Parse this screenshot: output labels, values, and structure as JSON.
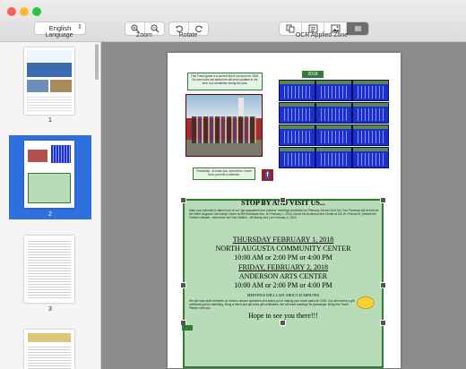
{
  "toolbar": {
    "language_value": "English",
    "language_label": "Language",
    "zoom_label": "Zoom",
    "rotate_label": "Rotate",
    "ocr_label": "OCR Applied Zone"
  },
  "icons": {
    "zoom_in": "zoom-in-icon",
    "zoom_out": "zoom-out-icon",
    "rotate_left": "rotate-left-icon",
    "rotate_right": "rotate-right-icon"
  },
  "sidebar": {
    "pages": [
      {
        "number": "1"
      },
      {
        "number": "2",
        "selected": true
      },
      {
        "number": "3"
      },
      {
        "number": ""
      }
    ],
    "selected_color": "#2f6fde"
  },
  "document": {
    "top_note": "This Travel guide is a current list of our tours for 2018. No new tours are added we will send updates in the form of a newsletter during the year.",
    "year_badge": "2018",
    "friendship_note": "Friendship - to know you, open them. Home turns you into a member.",
    "heading": "STOP BY AND VISIT US...",
    "intro": "Mark your calendar to attend one of our \"get acquainted tour preview\" meetings scheduled on February 1st and 2nd! Our Tour Previews will be held at the North Augusta Community Center at 495 Brookside Ave. on February 1, 2018, and at the Anderson Arts Center at 110 W. Federal St. (beside the Farmer's Market - behind the old Train Station - off Murray Ave.) on February 2, 2018.",
    "date1": "THURSDAY FEBRUARY 1, 2018",
    "venue1": "NORTH AUGUSTA COMMUNITY CENTER",
    "times1": "10:00 AM   or  2:00 PM   or   4:00 PM",
    "date2": "FRIDAY, FEBRUARY 2, 2018",
    "venue2": "ANDERSON ARTS CENTER",
    "times2": "10:00 AM   or  2:00 PM   or   4:00 PM",
    "meetings_note": "MEETINGS WILL LAST ABOUT 45 MINUTES",
    "closing": "We will have staff members on hand to answer questions and assist you in making your travel plans for 2018. You will receive a gift certificate just for attending. Bring a friend and get extra gift certificates. We will have drawings for giveaways. Bring this Travel Planner with you.",
    "signoff": "Hope to see you there!!!"
  }
}
